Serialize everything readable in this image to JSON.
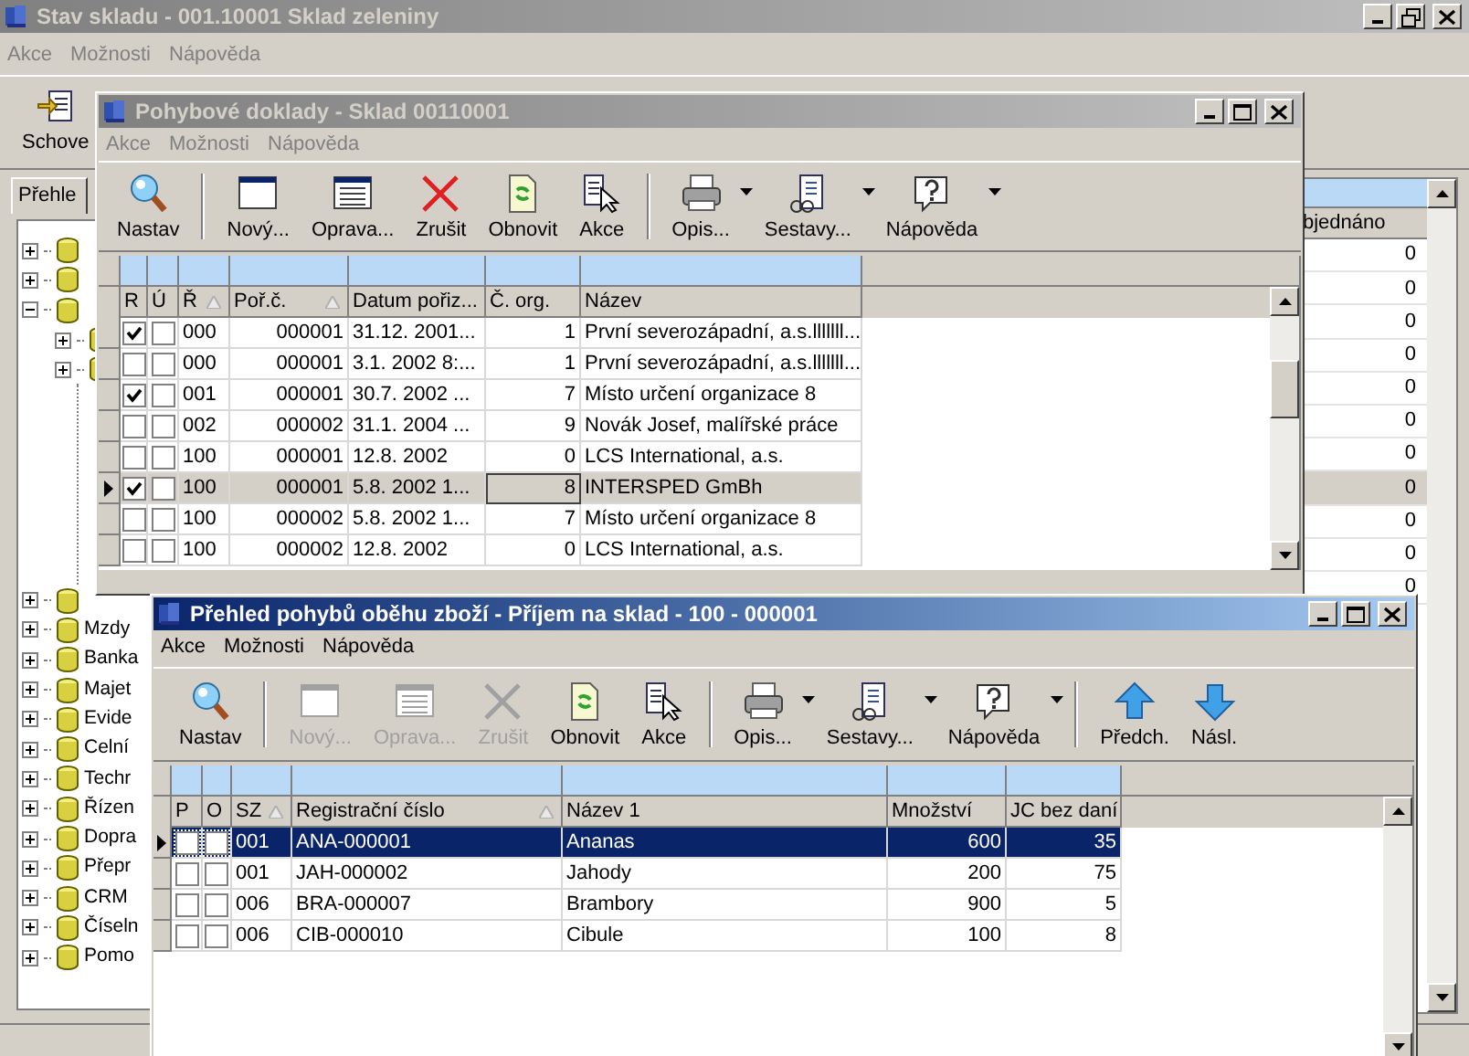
{
  "main_window": {
    "title": "Stav skladu - 001.10001 Sklad zeleniny",
    "active": false,
    "menu": [
      "Akce",
      "Možnosti",
      "Nápověda"
    ],
    "toolbar_button": "Schove",
    "tab": "Přehle",
    "tree": [
      {
        "expanded": false
      },
      {
        "expanded": false
      },
      {
        "expanded": true,
        "children": [
          {
            "expanded": false
          },
          {
            "expanded": false
          }
        ]
      },
      {
        "expanded": false
      },
      {
        "label": "Mzdy",
        "expanded": false
      },
      {
        "label": "Banka",
        "expanded": false
      },
      {
        "label": "Majet",
        "expanded": false
      },
      {
        "label": "Evide",
        "expanded": false
      },
      {
        "label": "Celní",
        "expanded": false
      },
      {
        "label": "Techr",
        "expanded": false
      },
      {
        "label": "Řízen",
        "expanded": false
      },
      {
        "label": "Dopra",
        "expanded": false
      },
      {
        "label": "Přepr",
        "expanded": false
      },
      {
        "label": "CRM",
        "expanded": false
      },
      {
        "label": "Číseln",
        "expanded": false
      },
      {
        "label": "Pomo",
        "expanded": false
      }
    ],
    "grid": {
      "column": "bjednáno",
      "rows": [
        {
          "value": "0",
          "selected": false
        },
        {
          "value": "0",
          "selected": false
        },
        {
          "value": "0",
          "selected": false
        },
        {
          "value": "0",
          "selected": false
        },
        {
          "value": "0",
          "selected": false
        },
        {
          "value": "0",
          "selected": false
        },
        {
          "value": "0",
          "selected": false
        },
        {
          "value": "0",
          "selected": true
        },
        {
          "value": "0",
          "selected": false
        },
        {
          "value": "0",
          "selected": false
        },
        {
          "value": "0",
          "selected": false
        }
      ]
    }
  },
  "documents_window": {
    "title": "Pohybové doklady - Sklad 00110001",
    "active": false,
    "menu": [
      "Akce",
      "Možnosti",
      "Nápověda"
    ],
    "toolbar": [
      {
        "kind": "search",
        "label": "Nastav",
        "disabled": false,
        "dropdown": false
      },
      {
        "kind": "separator"
      },
      {
        "kind": "window",
        "label": "Nový...",
        "disabled": false,
        "dropdown": false
      },
      {
        "kind": "form",
        "label": "Oprava...",
        "disabled": false,
        "dropdown": false
      },
      {
        "kind": "cross",
        "label": "Zrušit",
        "disabled": false,
        "dropdown": false
      },
      {
        "kind": "refresh",
        "label": "Obnovit",
        "disabled": false,
        "dropdown": false
      },
      {
        "kind": "pointer",
        "label": "Akce",
        "disabled": false,
        "dropdown": false
      },
      {
        "kind": "separator"
      },
      {
        "kind": "printer",
        "label": "Opis...",
        "disabled": false,
        "dropdown": true
      },
      {
        "kind": "report",
        "label": "Sestavy...",
        "disabled": false,
        "dropdown": true
      },
      {
        "kind": "help",
        "label": "Nápověda",
        "disabled": false,
        "dropdown": true
      }
    ],
    "check_columns": [
      "R",
      "Ú"
    ],
    "columns": [
      {
        "label": "Ř",
        "sorted": true
      },
      {
        "label": "Poř.č.",
        "sorted": true
      },
      {
        "label": "Datum pořiz...",
        "sorted": false
      },
      {
        "label": "Č. org.",
        "sorted": false
      },
      {
        "label": "Název",
        "sorted": false
      }
    ],
    "rows": [
      {
        "selected": false,
        "checks": [
          true,
          false
        ],
        "cells": [
          "000",
          "000001",
          "31.12. 2001...",
          "1",
          "První severozápadní, a.s.lllllll..."
        ]
      },
      {
        "selected": false,
        "checks": [
          false,
          false
        ],
        "cells": [
          "000",
          "000001",
          "3.1. 2002 8:...",
          "1",
          "První severozápadní, a.s.lllllll..."
        ]
      },
      {
        "selected": false,
        "checks": [
          true,
          false
        ],
        "cells": [
          "001",
          "000001",
          "30.7. 2002 ...",
          "7",
          "Místo určení organizace 8"
        ]
      },
      {
        "selected": false,
        "checks": [
          false,
          false
        ],
        "cells": [
          "002",
          "000002",
          "31.1. 2004 ...",
          "9",
          "Novák Josef, malířské práce"
        ]
      },
      {
        "selected": false,
        "checks": [
          false,
          false
        ],
        "cells": [
          "100",
          "000001",
          "12.8. 2002",
          "0",
          "LCS International, a.s."
        ]
      },
      {
        "selected": true,
        "checks": [
          true,
          false
        ],
        "cells": [
          "100",
          "000001",
          "5.8. 2002 1...",
          "8",
          "INTERSPED GmBh"
        ]
      },
      {
        "selected": false,
        "checks": [
          false,
          false
        ],
        "cells": [
          "100",
          "000002",
          "5.8. 2002 1...",
          "7",
          "Místo určení organizace 8"
        ]
      },
      {
        "selected": false,
        "checks": [
          false,
          false
        ],
        "cells": [
          "100",
          "000002",
          "12.8. 2002",
          "0",
          "LCS International, a.s."
        ]
      }
    ]
  },
  "movements_window": {
    "title": "Přehled pohybů oběhu zboží - Příjem na sklad - 100 - 000001",
    "active": true,
    "menu": [
      "Akce",
      "Možnosti",
      "Nápověda"
    ],
    "toolbar": [
      {
        "kind": "search",
        "label": "Nastav",
        "disabled": false,
        "dropdown": false
      },
      {
        "kind": "separator"
      },
      {
        "kind": "window",
        "label": "Nový...",
        "disabled": true,
        "dropdown": false
      },
      {
        "kind": "form",
        "label": "Oprava...",
        "disabled": true,
        "dropdown": false
      },
      {
        "kind": "cross",
        "label": "Zrušit",
        "disabled": true,
        "dropdown": false
      },
      {
        "kind": "refresh",
        "label": "Obnovit",
        "disabled": false,
        "dropdown": false
      },
      {
        "kind": "pointer",
        "label": "Akce",
        "disabled": false,
        "dropdown": false
      },
      {
        "kind": "separator"
      },
      {
        "kind": "printer",
        "label": "Opis...",
        "disabled": false,
        "dropdown": true
      },
      {
        "kind": "report",
        "label": "Sestavy...",
        "disabled": false,
        "dropdown": true
      },
      {
        "kind": "help",
        "label": "Nápověda",
        "disabled": false,
        "dropdown": true
      },
      {
        "kind": "separator"
      },
      {
        "kind": "up",
        "label": "Předch.",
        "disabled": false,
        "dropdown": false
      },
      {
        "kind": "down",
        "label": "Násl.",
        "disabled": false,
        "dropdown": false
      }
    ],
    "check_columns": [
      "P",
      "O"
    ],
    "columns": [
      {
        "label": "SZ",
        "sorted": true
      },
      {
        "label": "Registrační číslo",
        "sorted": true
      },
      {
        "label": "Název 1",
        "sorted": false
      },
      {
        "label": "Množství",
        "sorted": false
      },
      {
        "label": "JC bez daní",
        "sorted": false
      }
    ],
    "rows": [
      {
        "selected": true,
        "checks": [
          false,
          false
        ],
        "cells": [
          "001",
          "ANA-000001",
          "Ananas",
          "600",
          "35"
        ]
      },
      {
        "selected": false,
        "checks": [
          false,
          false
        ],
        "cells": [
          "001",
          "JAH-000002",
          "Jahody",
          "200",
          "75"
        ]
      },
      {
        "selected": false,
        "checks": [
          false,
          false
        ],
        "cells": [
          "006",
          "BRA-000007",
          "Brambory",
          "900",
          "5"
        ]
      },
      {
        "selected": false,
        "checks": [
          false,
          false
        ],
        "cells": [
          "006",
          "CIB-000010",
          "Cibule",
          "100",
          "8"
        ]
      }
    ]
  }
}
